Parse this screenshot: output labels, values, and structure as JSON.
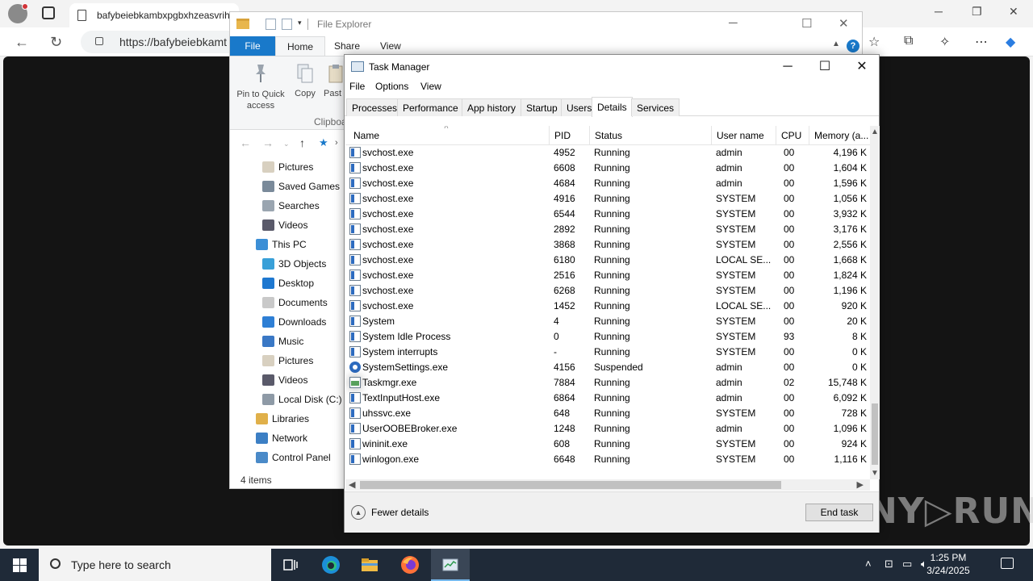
{
  "browser": {
    "tab_title": "bafybeiebkambxpgbxhzeasvrihc",
    "address": "https://bafybeiebkamt",
    "win_min": "─",
    "win_restore": "❐",
    "win_close": "✕"
  },
  "watermark": "ANY▷RUN",
  "explorer": {
    "title": "File Explorer",
    "ribbon_tabs": [
      "File",
      "Home",
      "Share",
      "View"
    ],
    "ribbon_buttons": [
      "Pin to Quick access",
      "Copy",
      "Past"
    ],
    "ribbon_group": "Clipboa",
    "tree": [
      {
        "label": "Pictures",
        "icon": "pictures-icon",
        "color": "#d8d0c0"
      },
      {
        "label": "Saved Games",
        "icon": "saved-games-icon",
        "color": "#7a8a9a"
      },
      {
        "label": "Searches",
        "icon": "searches-icon",
        "color": "#9aa5b0"
      },
      {
        "label": "Videos",
        "icon": "videos-icon",
        "color": "#5a5a6a"
      },
      {
        "label": "This PC",
        "icon": "this-pc-icon",
        "color": "#3c8fd6"
      },
      {
        "label": "3D Objects",
        "icon": "3d-objects-icon",
        "color": "#39a0d8"
      },
      {
        "label": "Desktop",
        "icon": "desktop-icon",
        "color": "#1e78d0"
      },
      {
        "label": "Documents",
        "icon": "documents-icon",
        "color": "#c9c9c9"
      },
      {
        "label": "Downloads",
        "icon": "downloads-icon",
        "color": "#2e7fd5"
      },
      {
        "label": "Music",
        "icon": "music-icon",
        "color": "#3a78c5"
      },
      {
        "label": "Pictures",
        "icon": "pictures-icon",
        "color": "#d8d0c0"
      },
      {
        "label": "Videos",
        "icon": "videos-icon",
        "color": "#5a5a6a"
      },
      {
        "label": "Local Disk (C:)",
        "icon": "local-disk-icon",
        "color": "#8e9aa6"
      },
      {
        "label": "Libraries",
        "icon": "libraries-icon",
        "color": "#e0b04a"
      },
      {
        "label": "Network",
        "icon": "network-icon",
        "color": "#3c7fc4"
      },
      {
        "label": "Control Panel",
        "icon": "control-panel-icon",
        "color": "#4a8ac8"
      }
    ],
    "status": "4 items"
  },
  "taskmgr": {
    "title": "Task Manager",
    "menu": [
      "File",
      "Options",
      "View"
    ],
    "tabs": [
      "Processes",
      "Performance",
      "App history",
      "Startup",
      "Users",
      "Details",
      "Services"
    ],
    "active_tab": "Details",
    "columns": {
      "name": "Name",
      "pid": "PID",
      "status": "Status",
      "user": "User name",
      "cpu": "CPU",
      "mem": "Memory (a..."
    },
    "rows": [
      {
        "name": "svchost.exe",
        "pid": "4952",
        "status": "Running",
        "user": "admin",
        "cpu": "00",
        "mem": "4,196 K",
        "icon": "process-icon"
      },
      {
        "name": "svchost.exe",
        "pid": "6608",
        "status": "Running",
        "user": "admin",
        "cpu": "00",
        "mem": "1,604 K",
        "icon": "process-icon"
      },
      {
        "name": "svchost.exe",
        "pid": "4684",
        "status": "Running",
        "user": "admin",
        "cpu": "00",
        "mem": "1,596 K",
        "icon": "process-icon"
      },
      {
        "name": "svchost.exe",
        "pid": "4916",
        "status": "Running",
        "user": "SYSTEM",
        "cpu": "00",
        "mem": "1,056 K",
        "icon": "process-icon"
      },
      {
        "name": "svchost.exe",
        "pid": "6544",
        "status": "Running",
        "user": "SYSTEM",
        "cpu": "00",
        "mem": "3,932 K",
        "icon": "process-icon"
      },
      {
        "name": "svchost.exe",
        "pid": "2892",
        "status": "Running",
        "user": "SYSTEM",
        "cpu": "00",
        "mem": "3,176 K",
        "icon": "process-icon"
      },
      {
        "name": "svchost.exe",
        "pid": "3868",
        "status": "Running",
        "user": "SYSTEM",
        "cpu": "00",
        "mem": "2,556 K",
        "icon": "process-icon"
      },
      {
        "name": "svchost.exe",
        "pid": "6180",
        "status": "Running",
        "user": "LOCAL SE...",
        "cpu": "00",
        "mem": "1,668 K",
        "icon": "process-icon"
      },
      {
        "name": "svchost.exe",
        "pid": "2516",
        "status": "Running",
        "user": "SYSTEM",
        "cpu": "00",
        "mem": "1,824 K",
        "icon": "process-icon"
      },
      {
        "name": "svchost.exe",
        "pid": "6268",
        "status": "Running",
        "user": "SYSTEM",
        "cpu": "00",
        "mem": "1,196 K",
        "icon": "process-icon"
      },
      {
        "name": "svchost.exe",
        "pid": "1452",
        "status": "Running",
        "user": "LOCAL SE...",
        "cpu": "00",
        "mem": "920 K",
        "icon": "process-icon"
      },
      {
        "name": "System",
        "pid": "4",
        "status": "Running",
        "user": "SYSTEM",
        "cpu": "00",
        "mem": "20 K",
        "icon": "process-icon"
      },
      {
        "name": "System Idle Process",
        "pid": "0",
        "status": "Running",
        "user": "SYSTEM",
        "cpu": "93",
        "mem": "8 K",
        "icon": "process-icon"
      },
      {
        "name": "System interrupts",
        "pid": "-",
        "status": "Running",
        "user": "SYSTEM",
        "cpu": "00",
        "mem": "0 K",
        "icon": "process-icon"
      },
      {
        "name": "SystemSettings.exe",
        "pid": "4156",
        "status": "Suspended",
        "user": "admin",
        "cpu": "00",
        "mem": "0 K",
        "icon": "gear-icon"
      },
      {
        "name": "Taskmgr.exe",
        "pid": "7884",
        "status": "Running",
        "user": "admin",
        "cpu": "02",
        "mem": "15,748 K",
        "icon": "task-manager-icon"
      },
      {
        "name": "TextInputHost.exe",
        "pid": "6864",
        "status": "Running",
        "user": "admin",
        "cpu": "00",
        "mem": "6,092 K",
        "icon": "process-icon"
      },
      {
        "name": "uhssvc.exe",
        "pid": "648",
        "status": "Running",
        "user": "SYSTEM",
        "cpu": "00",
        "mem": "728 K",
        "icon": "process-icon"
      },
      {
        "name": "UserOOBEBroker.exe",
        "pid": "1248",
        "status": "Running",
        "user": "admin",
        "cpu": "00",
        "mem": "1,096 K",
        "icon": "process-icon"
      },
      {
        "name": "wininit.exe",
        "pid": "608",
        "status": "Running",
        "user": "SYSTEM",
        "cpu": "00",
        "mem": "924 K",
        "icon": "process-icon"
      },
      {
        "name": "winlogon.exe",
        "pid": "6648",
        "status": "Running",
        "user": "SYSTEM",
        "cpu": "00",
        "mem": "1,116 K",
        "icon": "process-icon"
      }
    ],
    "fewer_details": "Fewer details",
    "end_task": "End task"
  },
  "taskbar": {
    "search_placeholder": "Type here to search",
    "time": "1:25 PM",
    "date": "3/24/2025"
  }
}
